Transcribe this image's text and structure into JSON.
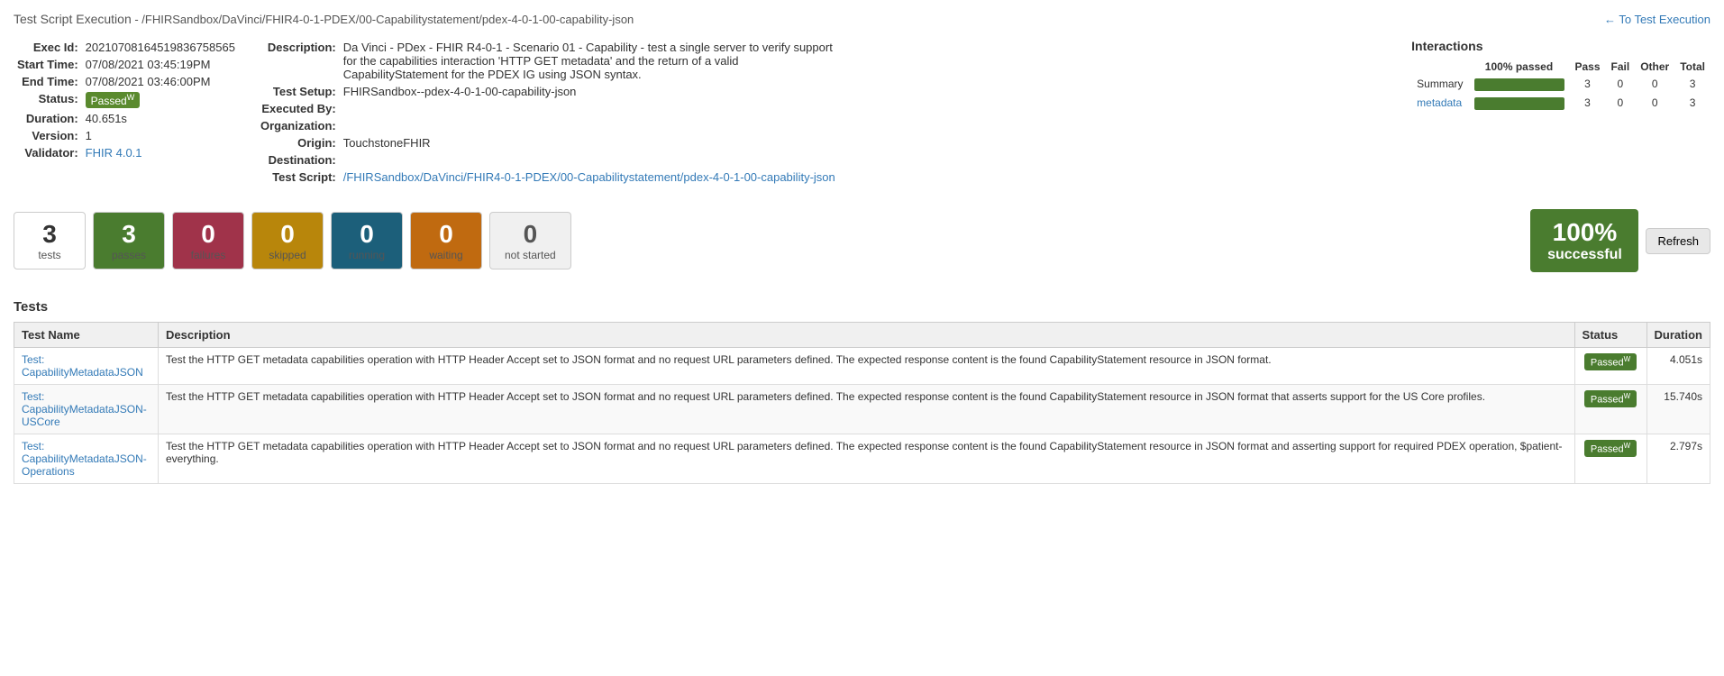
{
  "header": {
    "title": "Test Script Execution",
    "subtitle": " - /FHIRSandbox/DaVinci/FHIR4-0-1-PDEX/00-Capabilitystatement/pdex-4-0-1-00-capability-json",
    "back_label": "← To Test Execution",
    "back_href": "#"
  },
  "exec_info": {
    "exec_id_label": "Exec Id:",
    "exec_id": "20210708164519836758565",
    "start_time_label": "Start Time:",
    "start_time": "07/08/2021 03:45:19PM",
    "end_time_label": "End Time:",
    "end_time": "07/08/2021 03:46:00PM",
    "status_label": "Status:",
    "status": "Passed",
    "status_sup": "W",
    "duration_label": "Duration:",
    "duration": "40.651s",
    "version_label": "Version:",
    "version": "1",
    "validator_label": "Validator:",
    "validator": "FHIR 4.0.1"
  },
  "description_info": {
    "description_label": "Description:",
    "description": "Da Vinci - PDex - FHIR R4-0-1 - Scenario 01 - Capability - test a single server to verify support for the capabilities interaction 'HTTP GET metadata' and the return of a valid CapabilityStatement for the PDEX IG using JSON syntax.",
    "test_setup_label": "Test Setup:",
    "test_setup": "FHIRSandbox--pdex-4-0-1-00-capability-json",
    "executed_by_label": "Executed By:",
    "executed_by": "",
    "organization_label": "Organization:",
    "organization": "",
    "origin_label": "Origin:",
    "origin": "TouchstoneFHIR",
    "destination_label": "Destination:",
    "destination": "",
    "test_script_label": "Test Script:",
    "test_script": "/FHIRSandbox/DaVinci/FHIR4-0-1-PDEX/00-Capabilitystatement/pdex-4-0-1-00-capability-json"
  },
  "interactions": {
    "title": "Interactions",
    "col_pct": "100% passed",
    "col_pass": "Pass",
    "col_fail": "Fail",
    "col_other": "Other",
    "col_total": "Total",
    "rows": [
      {
        "name": "Summary",
        "pct": 100,
        "pass": 3,
        "fail": 0,
        "other": 0,
        "total": 3,
        "link": false
      },
      {
        "name": "metadata",
        "pct": 100,
        "pass": 3,
        "fail": 0,
        "other": 0,
        "total": 3,
        "link": true
      }
    ]
  },
  "stats": {
    "tests_num": "3",
    "tests_label": "tests",
    "passes_num": "3",
    "passes_label": "passes",
    "failures_num": "0",
    "failures_label": "failures",
    "skipped_num": "0",
    "skipped_label": "skipped",
    "running_num": "0",
    "running_label": "running",
    "waiting_num": "0",
    "waiting_label": "waiting",
    "not_started_num": "0",
    "not_started_label": "not started",
    "success_pct": "100%",
    "success_label": "successful",
    "refresh_label": "Refresh"
  },
  "tests_section": {
    "title": "Tests",
    "col_test_name": "Test Name",
    "col_description": "Description",
    "col_status": "Status",
    "col_duration": "Duration",
    "rows": [
      {
        "test_name": "Test: CapabilityMetadataJSON",
        "description": "Test the HTTP GET metadata capabilities operation with HTTP Header Accept set to JSON format and no request URL parameters defined. The expected response content is the found CapabilityStatement resource in JSON format.",
        "status": "Passed",
        "status_sup": "W",
        "duration": "4.051s"
      },
      {
        "test_name": "Test: CapabilityMetadataJSON-USCore",
        "description": "Test the HTTP GET metadata capabilities operation with HTTP Header Accept set to JSON format and no request URL parameters defined. The expected response content is the found CapabilityStatement resource in JSON format that asserts support for the US Core profiles.",
        "status": "Passed",
        "status_sup": "W",
        "duration": "15.740s"
      },
      {
        "test_name": "Test: CapabilityMetadataJSON-Operations",
        "description": "Test the HTTP GET metadata capabilities operation with HTTP Header Accept set to JSON format and no request URL parameters defined. The expected response content is the found CapabilityStatement resource in JSON format and asserting support for required PDEX operation, $patient-everything.",
        "status": "Passed",
        "status_sup": "W",
        "duration": "2.797s"
      }
    ]
  }
}
